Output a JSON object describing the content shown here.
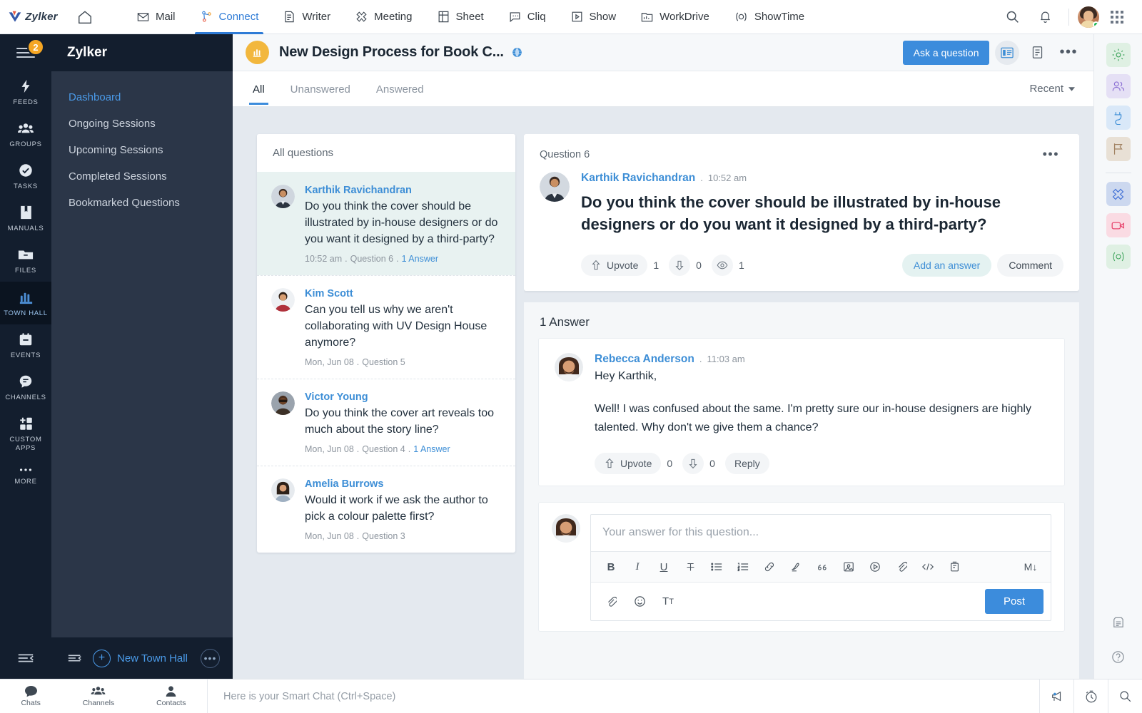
{
  "topbar": {
    "brand": "Zylker",
    "home_icon": "home-icon",
    "apps": [
      {
        "label": "Mail",
        "icon": "mail-icon",
        "active": false
      },
      {
        "label": "Connect",
        "icon": "connect-icon",
        "active": true
      },
      {
        "label": "Writer",
        "icon": "writer-icon",
        "active": false
      },
      {
        "label": "Meeting",
        "icon": "meeting-icon",
        "active": false
      },
      {
        "label": "Sheet",
        "icon": "sheet-icon",
        "active": false
      },
      {
        "label": "Cliq",
        "icon": "cliq-icon",
        "active": false
      },
      {
        "label": "Show",
        "icon": "show-icon",
        "active": false
      },
      {
        "label": "WorkDrive",
        "icon": "workdrive-icon",
        "active": false
      },
      {
        "label": "ShowTime",
        "icon": "showtime-icon",
        "active": false
      }
    ],
    "search_icon": "search-icon",
    "notification_icon": "bell-icon",
    "apps_grid_icon": "app-grid-icon",
    "accent": "#2e7bd6"
  },
  "rail": {
    "badge_count": "2",
    "items": [
      {
        "label": "FEEDS",
        "icon": "feeds-bolt-icon",
        "active": false
      },
      {
        "label": "GROUPS",
        "icon": "groups-icon",
        "active": false
      },
      {
        "label": "TASKS",
        "icon": "tasks-check-icon",
        "active": false
      },
      {
        "label": "MANUALS",
        "icon": "manuals-book-icon",
        "active": false
      },
      {
        "label": "FILES",
        "icon": "files-folder-icon",
        "active": false
      },
      {
        "label": "TOWN HALL",
        "icon": "town-hall-icon",
        "active": true
      },
      {
        "label": "EVENTS",
        "icon": "events-calendar-icon",
        "active": false
      },
      {
        "label": "CHANNELS",
        "icon": "channels-chat-icon",
        "active": false
      },
      {
        "label": "CUSTOM APPS",
        "icon": "custom-apps-icon",
        "active": false
      },
      {
        "label": "MORE",
        "icon": "more-dots-icon",
        "active": false
      }
    ]
  },
  "projnav": {
    "title": "Zylker",
    "items": [
      {
        "label": "Dashboard",
        "active": true
      },
      {
        "label": "Ongoing Sessions",
        "active": false
      },
      {
        "label": "Upcoming Sessions",
        "active": false
      },
      {
        "label": "Completed Sessions",
        "active": false
      },
      {
        "label": "Bookmarked Questions",
        "active": false
      }
    ],
    "new_button": "New Town Hall",
    "more_label": "•••"
  },
  "header": {
    "title": "New Design Process for Book C...",
    "visibility_icon": "globe-icon",
    "ask_button": "Ask a question",
    "view_grid_icon": "card-view-icon",
    "view_list_icon": "list-view-icon",
    "more_icon": "more-horizontal-icon"
  },
  "tabs": {
    "items": [
      {
        "label": "All",
        "active": true
      },
      {
        "label": "Unanswered",
        "active": false
      },
      {
        "label": "Answered",
        "active": false
      }
    ],
    "sort_label": "Recent"
  },
  "question_list": {
    "header": "All questions",
    "items": [
      {
        "author": "Karthik Ravichandran",
        "text": "Do you think the cover should be illustrated by in-house designers or do you want it designed by a third-party?",
        "time": "10:52 am",
        "number": "Question 6",
        "answers": "1 Answer",
        "selected": true
      },
      {
        "author": "Kim Scott",
        "text": "Can you tell us why we aren't collaborating with UV Design House anymore?",
        "time": "Mon, Jun 08",
        "number": "Question 5",
        "answers": "",
        "selected": false
      },
      {
        "author": "Victor Young",
        "text": "Do you think the cover art reveals too much about the story line?",
        "time": "Mon, Jun 08",
        "number": "Question 4",
        "answers": "1 Answer",
        "selected": false
      },
      {
        "author": "Amelia Burrows",
        "text": "Would it work if we ask the author to pick a colour palette first?",
        "time": "Mon, Jun 08",
        "number": "Question 3",
        "answers": "",
        "selected": false
      }
    ]
  },
  "detail": {
    "question_number": "Question 6",
    "more_icon": "more-horizontal-icon",
    "author": "Karthik Ravichandran",
    "time_sep": ".",
    "time": "10:52 am",
    "question": "Do you think the cover should be illustrated by in-house designers or do you want it designed by a third-party?",
    "upvote_label": "Upvote",
    "upvote_count": "1",
    "downvote_count": "0",
    "view_count": "1",
    "add_answer_label": "Add an answer",
    "comment_label": "Comment",
    "upvote_icon": "thumbs-up-icon",
    "downvote_icon": "thumbs-down-icon",
    "views_icon": "eye-icon"
  },
  "answers": {
    "title": "1 Answer",
    "list": [
      {
        "author": "Rebecca Anderson",
        "time_sep": ".",
        "time": "11:03 am",
        "greeting": "Hey Karthik,",
        "body": "Well! I was confused about the same. I'm pretty sure our in-house designers are highly talented. Why don't we give them a chance?",
        "upvote_label": "Upvote",
        "upvote_count": "0",
        "downvote_count": "0",
        "reply_label": "Reply"
      }
    ]
  },
  "editor": {
    "placeholder": "Your answer for this question...",
    "post_label": "Post",
    "tools": [
      {
        "icon": "bold-icon",
        "glyph": "B"
      },
      {
        "icon": "italic-icon",
        "glyph": "I"
      },
      {
        "icon": "underline-icon",
        "glyph": "U"
      },
      {
        "icon": "strikethrough-icon",
        "glyph": "T"
      },
      {
        "icon": "bullet-list-icon",
        "glyph": "•"
      },
      {
        "icon": "numbered-list-icon",
        "glyph": "1."
      },
      {
        "icon": "link-icon",
        "glyph": "link"
      },
      {
        "icon": "highlighter-icon",
        "glyph": "hl"
      },
      {
        "icon": "quote-icon",
        "glyph": "”"
      },
      {
        "icon": "image-icon",
        "glyph": "img"
      },
      {
        "icon": "video-icon",
        "glyph": "vid"
      },
      {
        "icon": "attachment-icon",
        "glyph": "clip"
      },
      {
        "icon": "code-icon",
        "glyph": "</>"
      },
      {
        "icon": "embed-icon",
        "glyph": "emb"
      },
      {
        "icon": "markdown-icon",
        "glyph": "M↓"
      }
    ],
    "bottom_tools": [
      {
        "icon": "attachment-icon"
      },
      {
        "icon": "emoji-icon"
      },
      {
        "icon": "text-format-icon"
      }
    ]
  },
  "right_rail": {
    "items": [
      {
        "icon": "gear-icon",
        "color": "#3fa45c",
        "bg": "#dff0e3"
      },
      {
        "icon": "people-icon",
        "color": "#8b6fd4",
        "bg": "#e5e0f5"
      },
      {
        "icon": "connector-icon",
        "color": "#3d8ed6",
        "bg": "#d9e8f8"
      },
      {
        "icon": "flag-icon",
        "color": "#a08060",
        "bg": "#e8e0d5"
      },
      {
        "icon": "meeting-icon",
        "color": "#3d6ed6",
        "bg": "#ccd8ef"
      },
      {
        "icon": "video-camera-icon",
        "color": "#e8476f",
        "bg": "#fadbe3"
      },
      {
        "icon": "showtime-icon",
        "color": "#3fa45c",
        "bg": "#dff0e3"
      }
    ],
    "bottom_items": [
      {
        "icon": "clipboard-icon"
      },
      {
        "icon": "help-icon"
      }
    ]
  },
  "bottombar": {
    "items": [
      {
        "label": "Chats",
        "icon": "chat-bubble-icon"
      },
      {
        "label": "Channels",
        "icon": "channels-group-icon"
      },
      {
        "label": "Contacts",
        "icon": "contact-person-icon"
      }
    ],
    "smart_chat_placeholder": "Here is your Smart Chat (Ctrl+Space)",
    "right_icons": [
      {
        "icon": "announcement-icon"
      },
      {
        "icon": "reminder-icon"
      },
      {
        "icon": "search-icon"
      }
    ]
  }
}
